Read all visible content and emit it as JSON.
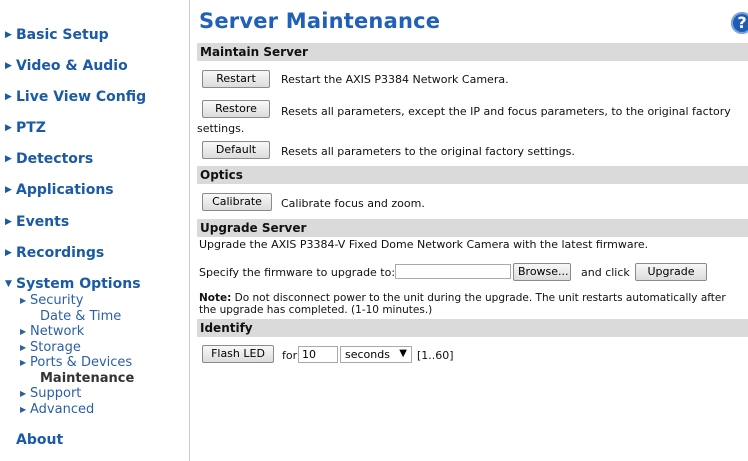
{
  "sidebar": {
    "items": [
      {
        "label": "Basic Setup"
      },
      {
        "label": "Video & Audio"
      },
      {
        "label": "Live View Config"
      },
      {
        "label": "PTZ"
      },
      {
        "label": "Detectors"
      },
      {
        "label": "Applications"
      },
      {
        "label": "Events"
      },
      {
        "label": "Recordings"
      },
      {
        "label": "System Options"
      }
    ],
    "sub_items": [
      {
        "label": "Security"
      },
      {
        "label": "Date & Time"
      },
      {
        "label": "Network"
      },
      {
        "label": "Storage"
      },
      {
        "label": "Ports & Devices"
      },
      {
        "label": "Maintenance"
      },
      {
        "label": "Support"
      },
      {
        "label": "Advanced"
      }
    ],
    "about": "About"
  },
  "main": {
    "title": "Server Maintenance",
    "help_icon": "?",
    "sections": {
      "maintain": {
        "header": "Maintain Server",
        "restart_button": "Restart",
        "restart_desc": "Restart the AXIS P3384 Network Camera.",
        "restore_button": "Restore",
        "restore_desc": "Resets all parameters, except the IP and focus parameters, to the original factory settings.",
        "default_button": "Default",
        "default_desc": "Resets all parameters to the original factory settings."
      },
      "optics": {
        "header": "Optics",
        "calibrate_button": "Calibrate",
        "calibrate_desc": "Calibrate focus and zoom."
      },
      "upgrade": {
        "header": "Upgrade Server",
        "intro": "Upgrade the AXIS P3384-V Fixed Dome Network Camera with the latest firmware.",
        "specify_label": "Specify the firmware to upgrade to:",
        "file_value": "",
        "browse_button": "Browse...",
        "and_click": "and click",
        "upgrade_button": "Upgrade",
        "note_label": "Note:",
        "note_text": " Do not disconnect power to the unit during the upgrade. The unit restarts automatically after the upgrade has completed. (1-10 minutes.)"
      },
      "identify": {
        "header": "Identify",
        "flash_button": "Flash LED",
        "for_label": "for",
        "duration_value": "10",
        "unit_selected": "seconds",
        "range": "[1..60]"
      }
    }
  },
  "colors": {
    "nav_link": "#1a5aa6",
    "title": "#2060b8",
    "section_bar": "#dadada"
  },
  "icons": {
    "nav_arrow": "triangle-right-icon",
    "expanded_arrow": "triangle-down-icon",
    "help": "help-icon"
  }
}
